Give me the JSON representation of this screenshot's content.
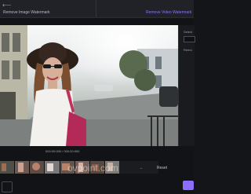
{
  "topbar": {
    "title": "Remove Image Watermark",
    "active_tab": "Remove Video Watermark"
  },
  "player": {
    "timecode": "000:00:000 / 000:20:000"
  },
  "sidepanel": {
    "label1": "Select",
    "label2": "Remo"
  },
  "controls": {
    "a": "←",
    "b": "Reset"
  },
  "watermark": {
    "text": "ovpoint.com"
  },
  "colors": {
    "accent": "#8c6dff",
    "panel": "#1a1b1f",
    "topbar": "#202227"
  }
}
